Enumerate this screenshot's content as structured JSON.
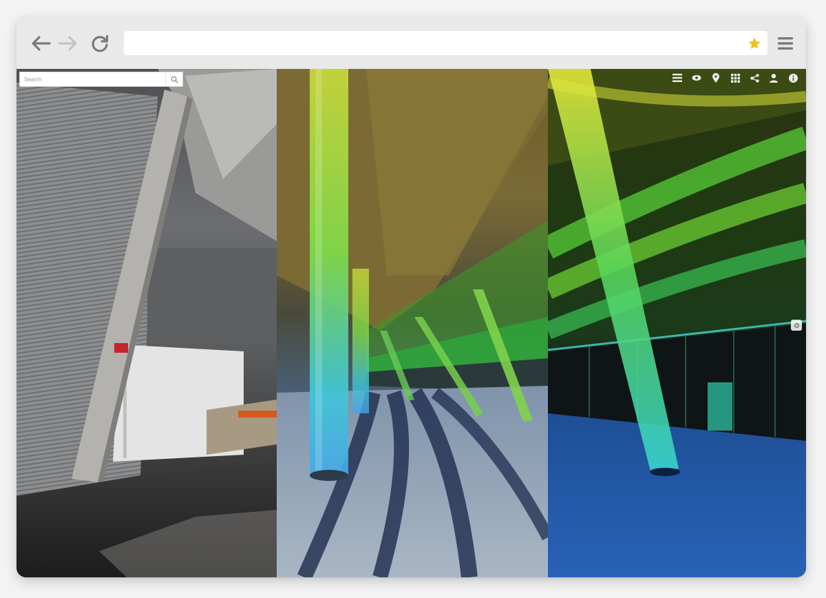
{
  "browser": {
    "url": "",
    "icons": {
      "back": "arrow-left-icon",
      "forward": "arrow-right-icon",
      "reload": "reload-icon",
      "bookmark": "star-icon",
      "menu": "hamburger-menu-icon"
    },
    "colors": {
      "toolbar": "#e9e9e9",
      "icon": "#7a7a7a",
      "icon_disabled": "#c4c4c4",
      "star": "#f2c21b"
    }
  },
  "viewer": {
    "search": {
      "placeholder": "Search"
    },
    "tools": [
      {
        "name": "layers-icon"
      },
      {
        "name": "eye-icon"
      },
      {
        "name": "location-pin-icon"
      },
      {
        "name": "grid-icon"
      },
      {
        "name": "share-icon"
      },
      {
        "name": "user-icon"
      },
      {
        "name": "info-icon"
      }
    ],
    "panels": [
      "photo",
      "photo-pointcloud-overlay",
      "pointcloud"
    ]
  }
}
